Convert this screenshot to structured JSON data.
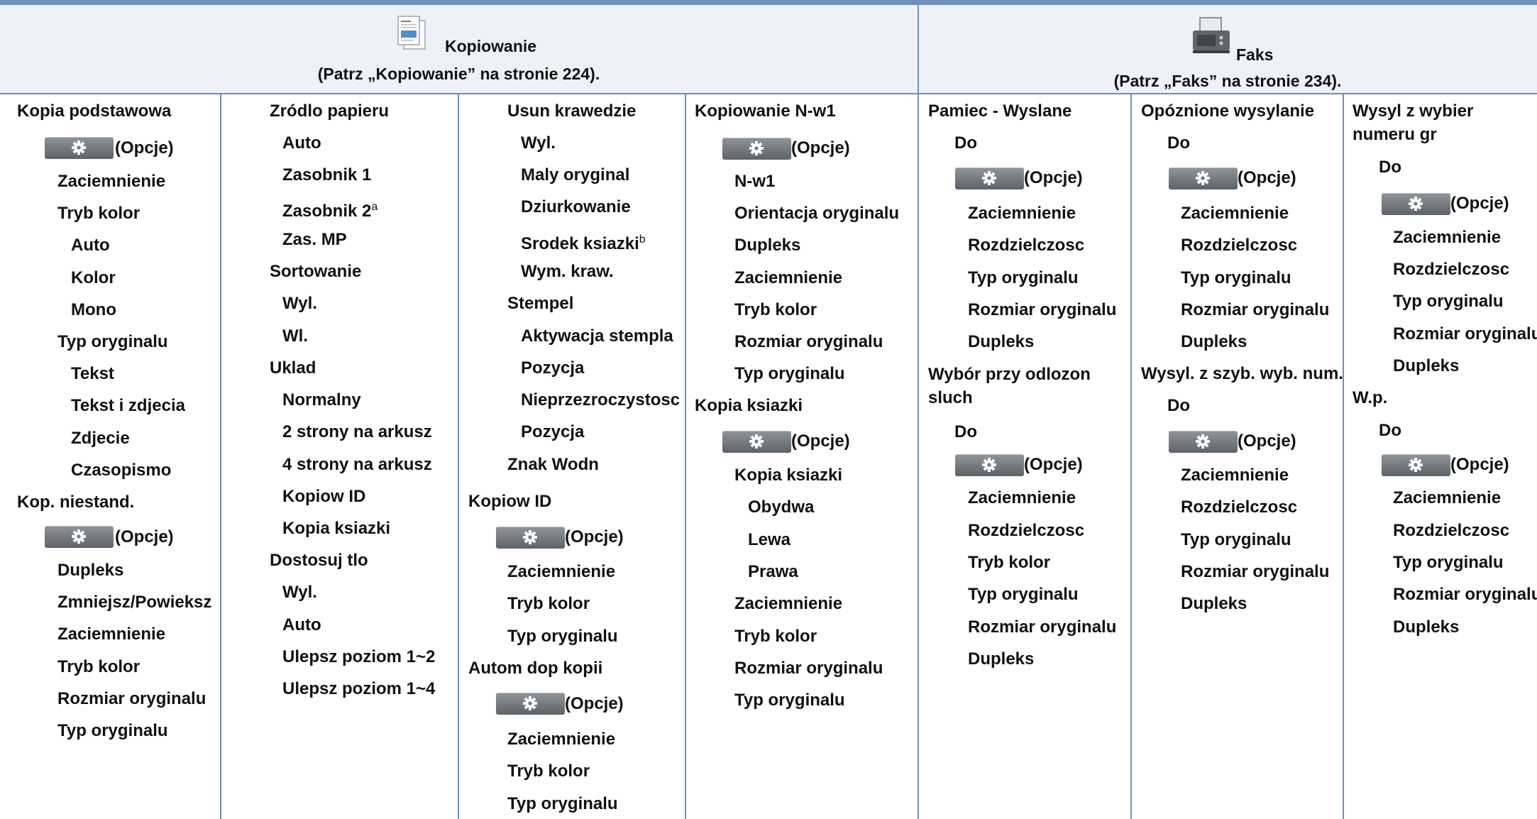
{
  "header": {
    "copy": {
      "title": "Kopiowanie",
      "ref": "(Patrz „Kopiowanie” na stronie 224)."
    },
    "fax": {
      "title": "Faks",
      "ref": "(Patrz „Faks” na stronie 234)."
    }
  },
  "options_label": "(Opcje)",
  "footnotes": {
    "a": "a",
    "b": "b"
  },
  "columns": [
    {
      "items": [
        "Kopia podstawowa",
        "Zaciemnienie",
        "Tryb kolor",
        "Auto",
        "Kolor",
        "Mono",
        "Typ oryginalu",
        "Tekst",
        "Tekst i zdjecia",
        "Zdjecie",
        "Czasopismo",
        "Kop. niestand.",
        "Dupleks",
        "Zmniejsz/Powieksz",
        "Zaciemnienie",
        "Tryb kolor",
        "Rozmiar oryginalu",
        "Typ oryginalu"
      ]
    },
    {
      "items": [
        "Zródlo papieru",
        "Auto",
        "Zasobnik 1",
        "Zasobnik 2",
        "Zas. MP",
        "Sortowanie",
        "Wyl.",
        "Wl.",
        "Uklad",
        "Normalny",
        "2 strony na arkusz",
        "4 strony na arkusz",
        "Kopiow ID",
        "Kopia ksiazki",
        "Dostosuj tlo",
        "Wyl.",
        "Auto",
        "Ulepsz poziom 1~2",
        "Ulepsz poziom 1~4"
      ]
    },
    {
      "items": [
        "Usun krawedzie",
        "Wyl.",
        "Maly oryginal",
        "Dziurkowanie",
        "Srodek ksiazki",
        "Wym. kraw.",
        "Stempel",
        "Aktywacja stempla",
        "Pozycja",
        "Nieprzezroczystosc",
        "Pozycja",
        "Znak Wodn",
        "Kopiow ID",
        "Zaciemnienie",
        "Tryb kolor",
        "Typ oryginalu",
        "Autom dop kopii",
        "Zaciemnienie",
        "Tryb kolor",
        "Typ oryginalu"
      ]
    },
    {
      "items": [
        "Kopiowanie N-w1",
        "N-w1",
        "Orientacja oryginalu",
        "Dupleks",
        "Zaciemnienie",
        "Tryb kolor",
        "Rozmiar oryginalu",
        "Typ oryginalu",
        "Kopia ksiazki",
        "Kopia ksiazki",
        "Obydwa",
        "Lewa",
        "Prawa",
        "Zaciemnienie",
        "Tryb kolor",
        "Rozmiar oryginalu",
        "Typ oryginalu"
      ]
    },
    {
      "items": [
        "Pamiec - Wyslane",
        "Do",
        "Zaciemnienie",
        "Rozdzielczosc",
        "Typ oryginalu",
        "Rozmiar oryginalu",
        "Dupleks",
        "Wybór przy odlozon sluch",
        "Do",
        "Zaciemnienie",
        "Rozdzielczosc",
        "Tryb kolor",
        "Typ oryginalu",
        "Rozmiar oryginalu",
        "Dupleks"
      ]
    },
    {
      "items": [
        "Opóznione wysylanie",
        "Do",
        "Zaciemnienie",
        "Rozdzielczosc",
        "Typ oryginalu",
        "Rozmiar oryginalu",
        "Dupleks",
        "Wysyl. z szyb. wyb. num.",
        "Do",
        "Zaciemnienie",
        "Rozdzielczosc",
        "Typ oryginalu",
        "Rozmiar oryginalu",
        "Dupleks"
      ]
    },
    {
      "items": [
        "Wysyl z wybier numeru gr",
        "Do",
        "Zaciemnienie",
        "Rozdzielczosc",
        "Typ oryginalu",
        "Rozmiar oryginalu",
        "Dupleks",
        "W.p.",
        "Do",
        "Zaciemnienie",
        "Rozdzielczosc",
        "Typ oryginalu",
        "Rozmiar oryginalu",
        "Dupleks"
      ]
    }
  ]
}
